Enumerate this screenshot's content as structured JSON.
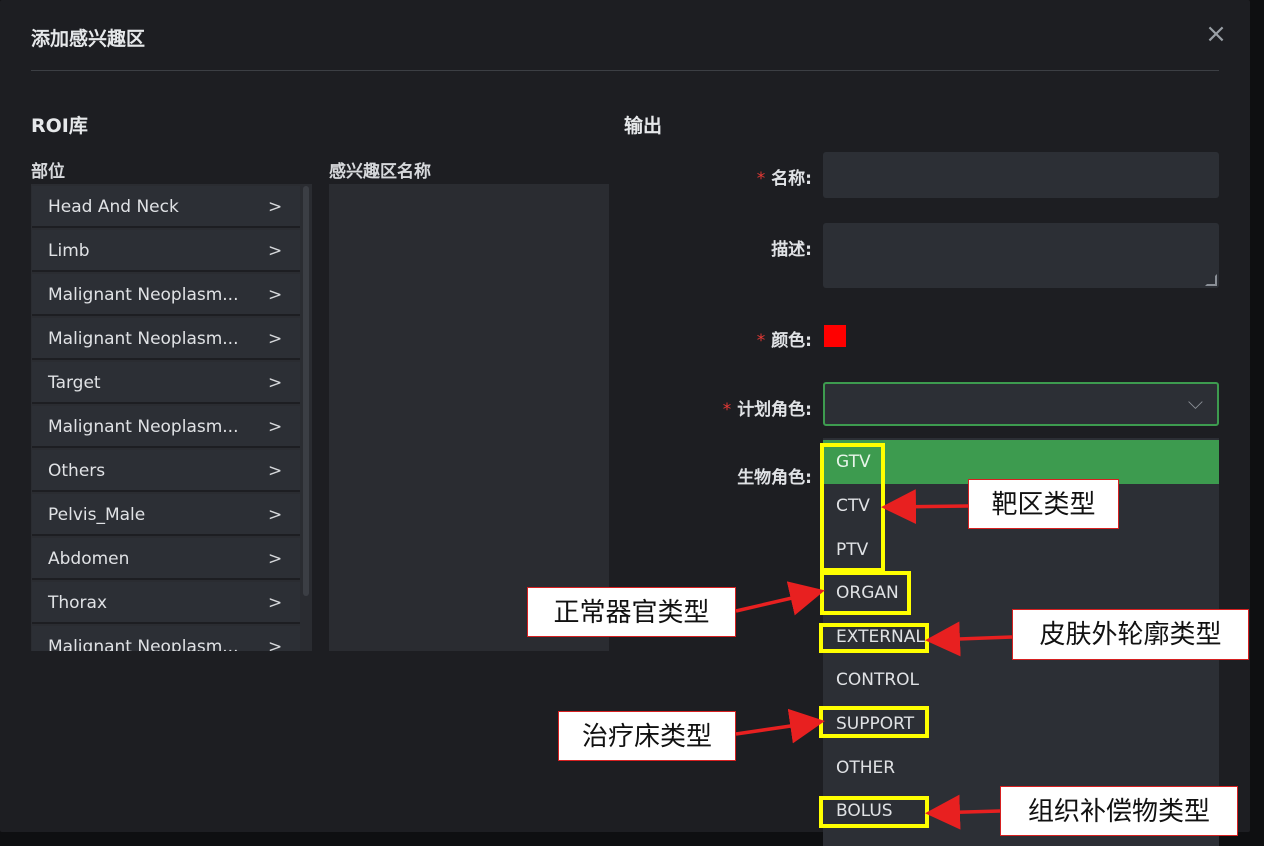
{
  "dialog": {
    "title": "添加感兴趣区",
    "close_glyph": "×"
  },
  "left": {
    "section_title": "ROI库",
    "site_label": "部位",
    "name_label": "感兴趣区名称",
    "sites": [
      "Head And Neck",
      "Limb",
      "Malignant Neoplasm...",
      "Malignant Neoplasm...",
      "Target",
      "Malignant Neoplasm...",
      "Others",
      "Pelvis_Male",
      "Abdomen",
      "Thorax",
      "Malignant Neoplasm..."
    ],
    "chevron": ">"
  },
  "output": {
    "section_title": "输出",
    "required_mark": "*",
    "name_label": "名称:",
    "desc_label": "描述:",
    "color_label": "颜色:",
    "color_value": "#ff0000",
    "plan_role_label": "计划角色:",
    "bio_role_label": "生物角色:",
    "plan_role_value": "",
    "plan_role_options": [
      "GTV",
      "CTV",
      "PTV",
      "ORGAN",
      "EXTERNAL",
      "CONTROL",
      "SUPPORT",
      "OTHER",
      "BOLUS"
    ],
    "plan_role_highlighted": "GTV",
    "chevron_down": "⌵"
  },
  "annotations": {
    "target_type": "靶区类型",
    "organ_type": "正常器官类型",
    "skin_type": "皮肤外轮廓类型",
    "couch_type": "治疗床类型",
    "bolus_type": "组织补偿物类型"
  },
  "colors": {
    "accent_green": "#3d9b4f",
    "highlight_yellow": "#ffff00",
    "arrow_red": "#e82020"
  }
}
